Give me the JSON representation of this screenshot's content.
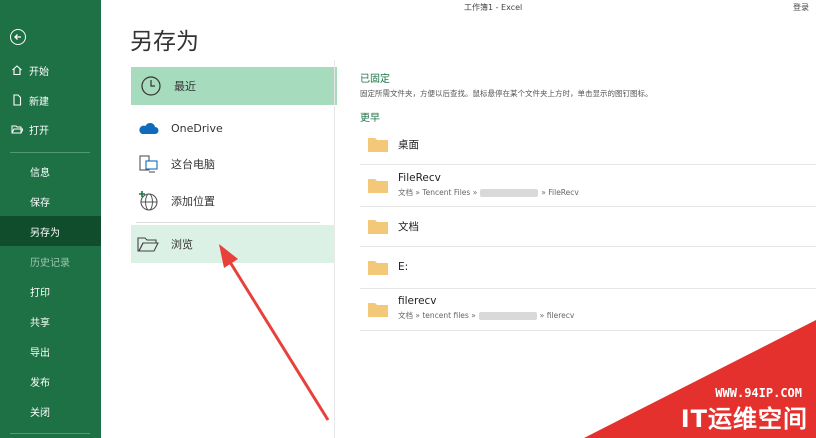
{
  "titlebar": {
    "title": "工作簿1  -  Excel",
    "login": "登录"
  },
  "sidebar": {
    "top_items": [
      {
        "label": "开始",
        "icon": "home-icon"
      },
      {
        "label": "新建",
        "icon": "new-document-icon"
      },
      {
        "label": "打开",
        "icon": "open-folder-icon"
      }
    ],
    "items": [
      {
        "label": "信息"
      },
      {
        "label": "保存"
      },
      {
        "label": "另存为",
        "active": true
      },
      {
        "label": "历史记录",
        "disabled": true
      },
      {
        "label": "打印"
      },
      {
        "label": "共享"
      },
      {
        "label": "导出"
      },
      {
        "label": "发布"
      },
      {
        "label": "关闭"
      }
    ]
  },
  "page": {
    "title": "另存为"
  },
  "locations": [
    {
      "label": "最近",
      "icon": "clock-icon"
    },
    {
      "label": "OneDrive",
      "icon": "cloud-icon"
    },
    {
      "label": "这台电脑",
      "icon": "computer-icon"
    },
    {
      "label": "添加位置",
      "icon": "globe-add-icon"
    },
    {
      "label": "浏览",
      "icon": "folder-open-icon"
    }
  ],
  "pinned": {
    "title": "已固定",
    "description": "固定所需文件夹，方便以后查找。鼠标悬停在某个文件夹上方时，单击显示的图钉图标。"
  },
  "older": {
    "title": "更早",
    "folders": [
      {
        "name": "桌面"
      },
      {
        "name": "FileRecv",
        "path_start": "文档 » Tencent Files »",
        "path_end": "» FileRecv"
      },
      {
        "name": "文档"
      },
      {
        "name": "E:"
      },
      {
        "name": "filerecv",
        "path_start": "文档 » tencent files »",
        "path_end": "» filerecv"
      }
    ]
  },
  "watermark": {
    "url": "WWW.94IP.COM",
    "brand": "IT运维空间"
  },
  "colors": {
    "accent": "#1e7145",
    "selected": "#a7dbbd",
    "hover": "#dcf1e5",
    "folder": "#f3c878",
    "arrow": "#e8403a"
  }
}
